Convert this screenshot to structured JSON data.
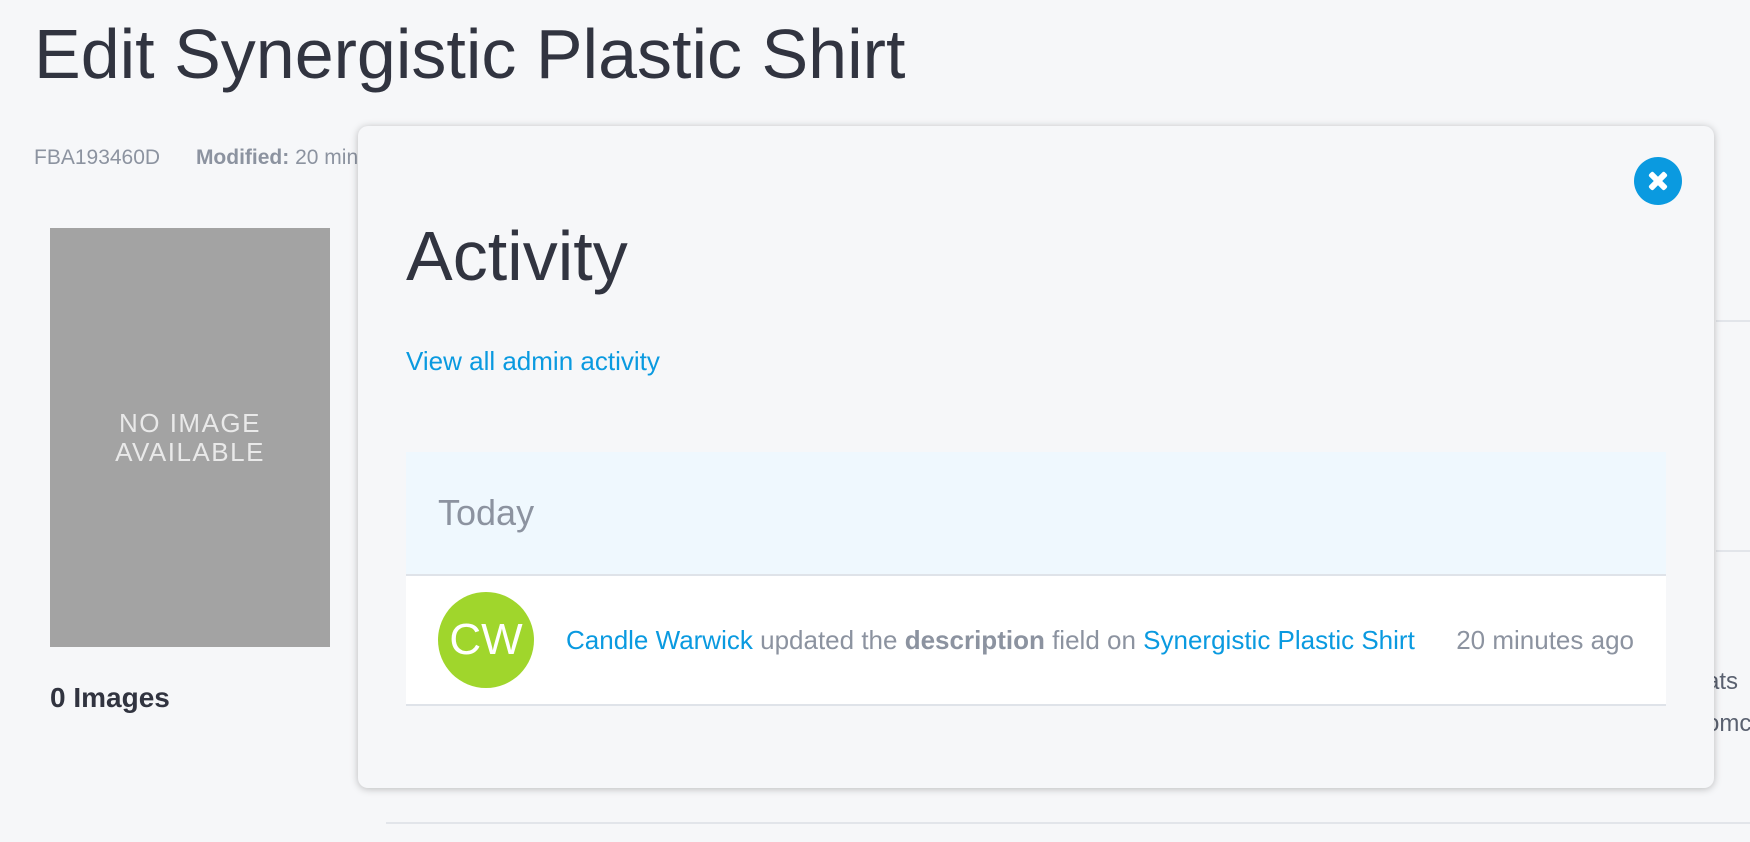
{
  "page": {
    "title": "Edit Synergistic Plastic Shirt",
    "sku": "FBA193460D",
    "modified_label": "Modified:",
    "modified_value": "20 min",
    "no_image_text": "NO IMAGE AVAILABLE",
    "images_count": "0 Images",
    "background_fragments": [
      "ats",
      "omc"
    ]
  },
  "modal": {
    "title": "Activity",
    "admin_link": "View all admin activity",
    "close_icon": "close-icon",
    "groups": [
      {
        "label": "Today",
        "items": [
          {
            "avatar_initials": "CW",
            "avatar_color": "#a0d62c",
            "user": "Candle Warwick",
            "action_prefix": "updated the",
            "field": "description",
            "action_suffix": "field on",
            "target": "Synergistic Plastic Shirt",
            "time": "20 minutes ago"
          }
        ]
      }
    ]
  },
  "colors": {
    "accent": "#0a9ae0",
    "page_background": "#f6f7f9",
    "muted_text": "#8c93a0",
    "day_header_background": "#eff8fe"
  }
}
